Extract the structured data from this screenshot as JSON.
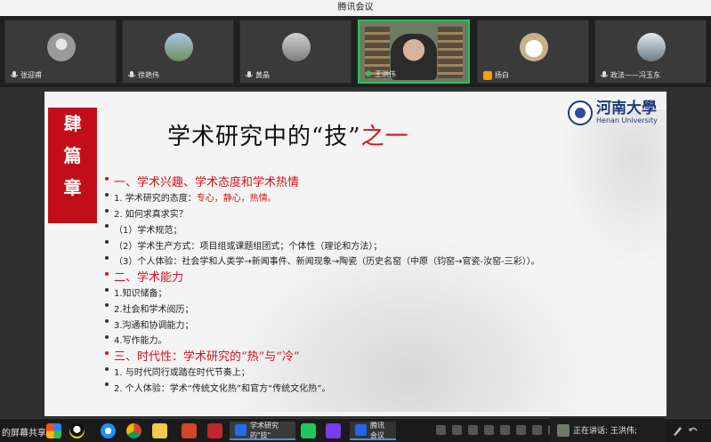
{
  "window": {
    "title": "腾讯会议"
  },
  "participants": [
    {
      "name": "张迎甫",
      "video": false
    },
    {
      "name": "徐艳伟",
      "video": false
    },
    {
      "name": "黄晶",
      "video": false
    },
    {
      "name": "王洪伟",
      "video": true
    },
    {
      "name": "扬白",
      "video": false
    },
    {
      "name": "政法——冯玉东",
      "video": false
    }
  ],
  "slide": {
    "side_label": [
      "肆",
      "篇",
      "章"
    ],
    "title_main": "学术研究中的“技”",
    "title_red": "之一",
    "logo": {
      "cn": "河南大學",
      "en": "Henan University"
    },
    "lines": [
      {
        "type": "head",
        "text": "一、学术兴趣、学术态度和学术热情"
      },
      {
        "type": "item",
        "text": "1. 学术研究的态度：",
        "red": "专心，静心，热情。"
      },
      {
        "type": "item",
        "text": "2. 如何求真求实？"
      },
      {
        "type": "item",
        "text": "（1）学术规范；"
      },
      {
        "type": "item",
        "text": "（2）学术生产方式：项目组或课题组团式；个体性（理论和方法）；"
      },
      {
        "type": "item",
        "text": "（3）个人体验：社会学和人类学→新闻事件、新闻现象→陶瓷（历史名窑（中原（钧窑→官瓷-汝窑-三彩））。"
      },
      {
        "type": "head",
        "text": "二、学术能力"
      },
      {
        "type": "item",
        "text": "1.知识储备；"
      },
      {
        "type": "item",
        "text": "2.社会和学术阅历；"
      },
      {
        "type": "item",
        "text": "3.沟通和协调能力；"
      },
      {
        "type": "item",
        "text": "4.写作能力。"
      },
      {
        "type": "head",
        "text": "三、时代性：学术研究的“热”与“冷”"
      },
      {
        "type": "item",
        "text": "1. 与时代同行或踏在时代节奏上；"
      },
      {
        "type": "item",
        "text": "2. 个人体验：学术“传统文化热”和官方“传统文化热”。"
      }
    ]
  },
  "screen_share": {
    "label": "的屏幕共享"
  },
  "taskbar": {
    "items": [
      {
        "label": "学术研究的\"技\""
      },
      {
        "label": "腾讯会议"
      }
    ]
  },
  "speaking": {
    "label": "正在讲话: 王洪伟;"
  },
  "colors": {
    "accent_red": "#d3121b",
    "band_red": "#c20e1a",
    "logo_blue": "#1f3a7a",
    "active_green": "#22c55e"
  }
}
